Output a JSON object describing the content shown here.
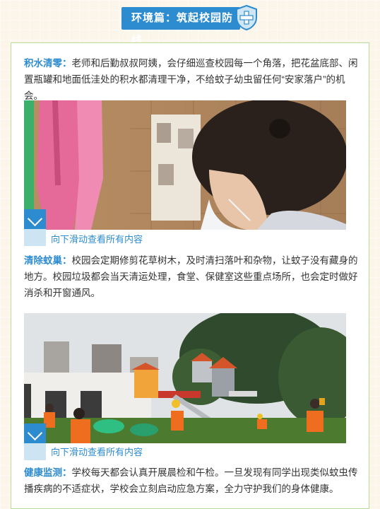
{
  "header": {
    "title": "环境篇：筑起校园防线"
  },
  "sections": [
    {
      "keyword": "积水清零：",
      "text": "老师和后勤叔叔阿姨，会仔细巡查校园每一个角落，把花盆底部、闲置瓶罐和地面低洼处的积水都清理干净，不给蚊子幼虫留任何“安家落户”的机会。",
      "scroll_hint": "向下滑动查看所有内容"
    },
    {
      "keyword": "清除蚊巢：",
      "text": "校园会定期修剪花草树木，及时清扫落叶和杂物，让蚊子没有藏身的地方。校园垃圾都会当天清运处理，食堂、保健室这些重点场所，也会定时做好消杀和开窗通风。",
      "scroll_hint": "向下滑动查看所有内容"
    },
    {
      "keyword": "健康监测：",
      "text": "学校每天都会认真开展晨检和午检。一旦发现有同学出现类似蚊虫传播疾病的不适症状，学校会立刻启动应急方案，全力守护我们的身体健康。"
    }
  ],
  "icons": {
    "header_badge": "medical-cross-shield-icon",
    "scroll": "chevron-down-icon"
  },
  "colors": {
    "accent": "#2d8ccf",
    "card_border": "#b7dc9a",
    "background": "#fbf5ea"
  }
}
